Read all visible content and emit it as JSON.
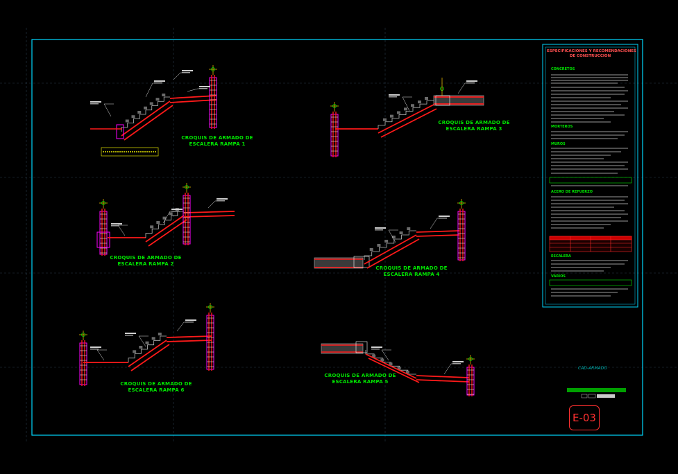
{
  "drawing": {
    "sheet_number": "E-03",
    "bg_color": "#000000",
    "frame_color": "#00d8ff",
    "rebar_color": "#ff1a1a",
    "column_color": "#ff00ff",
    "title_color": "#00e600",
    "label_color": "#d0d0d0"
  },
  "sketches": [
    {
      "title_line1": "CROQUIS DE ARMADO DE",
      "title_line2": "ESCALERA RAMPA 1"
    },
    {
      "title_line1": "CROQUIS DE ARMADO DE",
      "title_line2": "ESCALERA RAMPA 2"
    },
    {
      "title_line1": "CROQUIS DE ARMADO DE",
      "title_line2": "ESCALERA RAMPA 3"
    },
    {
      "title_line1": "CROQUIS DE ARMADO DE",
      "title_line2": "ESCALERA RAMPA 4"
    },
    {
      "title_line1": "CROQUIS DE ARMADO DE",
      "title_line2": "ESCALERA RAMPA 5"
    },
    {
      "title_line1": "CROQUIS DE ARMADO DE",
      "title_line2": "ESCALERA RAMPA 6"
    }
  ],
  "specs": {
    "title_line1": "ESPECIFICACIONES Y RECOMENDACIONES",
    "title_line2": "DE CONSTRUCCION",
    "section_heads": [
      "CONCRETOS",
      "MORTEROS",
      "MUROS",
      "ACERO DE REFUERZO",
      "ESCALERA",
      "VARIOS"
    ]
  },
  "stamp_text": "CAD-ARMADO"
}
